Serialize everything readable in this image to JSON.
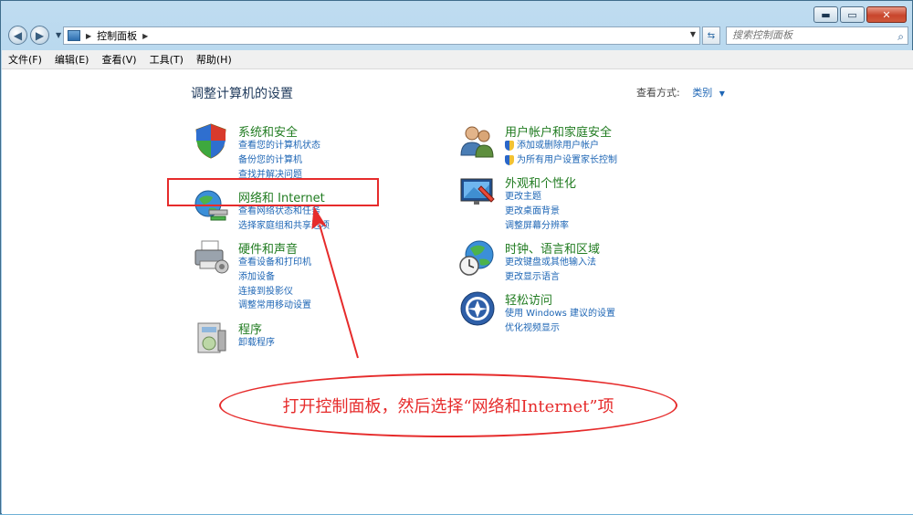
{
  "window": {
    "minimize": "▬",
    "maximize": "▭",
    "close": "✕"
  },
  "navbar": {
    "back": "◀",
    "forward": "▶",
    "breadcrumb": "控制面板",
    "search_placeholder": "搜索控制面板"
  },
  "menu": [
    "文件(F)",
    "编辑(E)",
    "查看(V)",
    "工具(T)",
    "帮助(H)"
  ],
  "content": {
    "heading": "调整计算机的设置",
    "view_by_label": "查看方式:",
    "view_by_value": "类别"
  },
  "categories_left": [
    {
      "title": "系统和安全",
      "icon": "shield-icon",
      "links": [
        "查看您的计算机状态",
        "备份您的计算机",
        "查找并解决问题"
      ]
    },
    {
      "title": "网络和 Internet",
      "icon": "network-globe-icon",
      "links": [
        "查看网络状态和任务",
        "选择家庭组和共享选项"
      ]
    },
    {
      "title": "硬件和声音",
      "icon": "printer-icon",
      "links": [
        "查看设备和打印机",
        "添加设备",
        "连接到投影仪",
        "调整常用移动设置"
      ]
    },
    {
      "title": "程序",
      "icon": "programs-icon",
      "links": [
        "卸载程序"
      ]
    }
  ],
  "categories_right": [
    {
      "title": "用户帐户和家庭安全",
      "icon": "users-icon",
      "links": [
        "添加或删除用户帐户",
        "为所有用户设置家长控制"
      ]
    },
    {
      "title": "外观和个性化",
      "icon": "appearance-icon",
      "links": [
        "更改主题",
        "更改桌面背景",
        "调整屏幕分辨率"
      ]
    },
    {
      "title": "时钟、语言和区域",
      "icon": "clock-globe-icon",
      "links": [
        "更改键盘或其他输入法",
        "更改显示语言"
      ]
    },
    {
      "title": "轻松访问",
      "icon": "ease-of-access-icon",
      "links": [
        "使用 Windows 建议的设置",
        "优化视频显示"
      ]
    }
  ],
  "annotation": {
    "text": "打开控制面板，然后选择“网络和Internet”项",
    "color": "#e62b2b"
  }
}
